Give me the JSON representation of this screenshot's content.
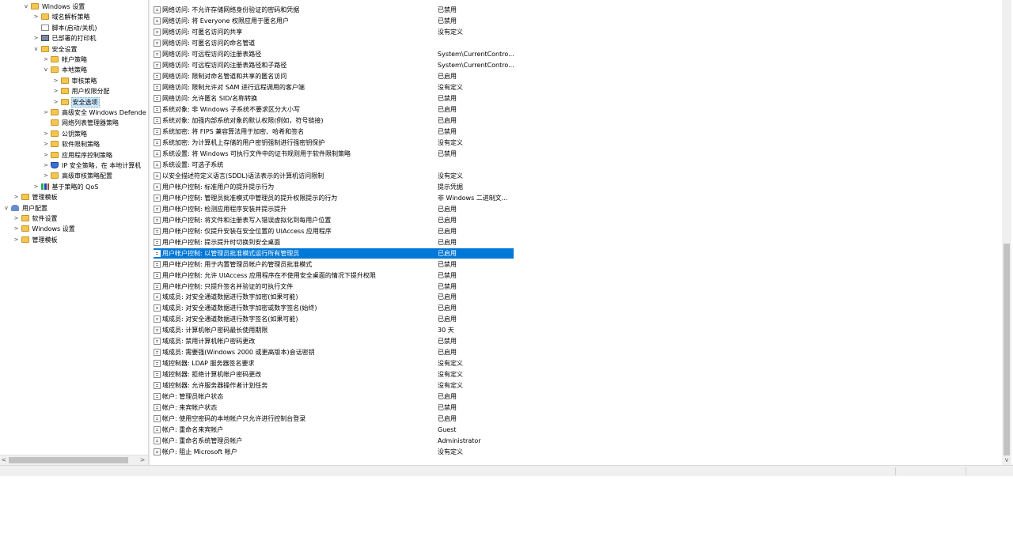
{
  "tree": [
    {
      "label": "Windows 设置",
      "level": 2,
      "toggle": "v",
      "icon": "folder"
    },
    {
      "label": "域名解析策略",
      "level": 3,
      "toggle": ">",
      "icon": "folder"
    },
    {
      "label": "脚本(启动/关机)",
      "level": 3,
      "toggle": "",
      "icon": "doc"
    },
    {
      "label": "已部署的打印机",
      "level": 3,
      "toggle": ">",
      "icon": "printer"
    },
    {
      "label": "安全设置",
      "level": 3,
      "toggle": "v",
      "icon": "folder"
    },
    {
      "label": "帐户策略",
      "level": 4,
      "toggle": ">",
      "icon": "folder"
    },
    {
      "label": "本地策略",
      "level": 4,
      "toggle": "v",
      "icon": "folder"
    },
    {
      "label": "审核策略",
      "level": 5,
      "toggle": ">",
      "icon": "folder"
    },
    {
      "label": "用户权限分配",
      "level": 5,
      "toggle": ">",
      "icon": "folder"
    },
    {
      "label": "安全选项",
      "level": 5,
      "toggle": ">",
      "icon": "folder",
      "selected": true
    },
    {
      "label": "高级安全 Windows Defender 防",
      "level": 4,
      "toggle": ">",
      "icon": "folder"
    },
    {
      "label": "网络列表管理器策略",
      "level": 4,
      "toggle": "",
      "icon": "folder"
    },
    {
      "label": "公钥策略",
      "level": 4,
      "toggle": ">",
      "icon": "folder"
    },
    {
      "label": "软件限制策略",
      "level": 4,
      "toggle": ">",
      "icon": "folder"
    },
    {
      "label": "应用程序控制策略",
      "level": 4,
      "toggle": ">",
      "icon": "folder"
    },
    {
      "label": "IP 安全策略，在 本地计算机",
      "level": 4,
      "toggle": ">",
      "icon": "shield"
    },
    {
      "label": "高级审核策略配置",
      "level": 4,
      "toggle": ">",
      "icon": "folder"
    },
    {
      "label": "基于策略的 QoS",
      "level": 3,
      "toggle": ">",
      "icon": "chart"
    },
    {
      "label": "管理模板",
      "level": 1,
      "toggle": ">",
      "icon": "folder"
    },
    {
      "label": "用户配置",
      "level": 0,
      "toggle": "v",
      "icon": "user"
    },
    {
      "label": "软件设置",
      "level": 1,
      "toggle": ">",
      "icon": "folder"
    },
    {
      "label": "Windows 设置",
      "level": 1,
      "toggle": ">",
      "icon": "folder"
    },
    {
      "label": "管理模板",
      "level": 1,
      "toggle": ">",
      "icon": "folder"
    }
  ],
  "policies": [
    {
      "name": "网络访问: 不允许存储网络身份验证的密码和凭据",
      "value": "已禁用"
    },
    {
      "name": "网络访问: 将 Everyone 权限应用于匿名用户",
      "value": "已禁用"
    },
    {
      "name": "网络访问: 可匿名访问的共享",
      "value": "没有定义"
    },
    {
      "name": "网络访问: 可匿名访问的命名管道",
      "value": ""
    },
    {
      "name": "网络访问: 可远程访问的注册表路径",
      "value": "System\\CurrentContro..."
    },
    {
      "name": "网络访问: 可远程访问的注册表路径和子路径",
      "value": "System\\CurrentContro..."
    },
    {
      "name": "网络访问: 限制对命名管道和共享的匿名访问",
      "value": "已启用"
    },
    {
      "name": "网络访问: 限制允许对 SAM 进行远程调用的客户端",
      "value": "没有定义"
    },
    {
      "name": "网络访问: 允许匿名 SID/名称转换",
      "value": "已禁用"
    },
    {
      "name": "系统对象: 非 Windows 子系统不要求区分大小写",
      "value": "已启用"
    },
    {
      "name": "系统对象: 加强内部系统对象的默认权限(例如，符号链接)",
      "value": "已启用"
    },
    {
      "name": "系统加密: 将 FIPS 兼容算法用于加密、哈希和签名",
      "value": "已禁用"
    },
    {
      "name": "系统加密: 为计算机上存储的用户密钥强制进行强密钥保护",
      "value": "没有定义"
    },
    {
      "name": "系统设置: 将 Windows 可执行文件中的证书规则用于软件限制策略",
      "value": "已禁用"
    },
    {
      "name": "系统设置: 可选子系统",
      "value": ""
    },
    {
      "name": "以安全描述符定义语言(SDDL)语法表示的计算机访问限制",
      "value": "没有定义"
    },
    {
      "name": "用户帐户控制: 标准用户的提升提示行为",
      "value": "提示凭据"
    },
    {
      "name": "用户帐户控制: 管理员批准模式中管理员的提升权限提示的行为",
      "value": "非 Windows 二进制文..."
    },
    {
      "name": "用户帐户控制: 检测应用程序安装并提示提升",
      "value": "已启用"
    },
    {
      "name": "用户帐户控制: 将文件和注册表写入错误虚拟化到每用户位置",
      "value": "已启用"
    },
    {
      "name": "用户帐户控制: 仅提升安装在安全位置的 UIAccess 应用程序",
      "value": "已启用"
    },
    {
      "name": "用户帐户控制: 提示提升时切换到安全桌面",
      "value": "已启用"
    },
    {
      "name": "用户帐户控制: 以管理员批准模式运行所有管理员",
      "value": "已启用",
      "selected": true
    },
    {
      "name": "用户帐户控制: 用于内置管理员帐户的管理员批准模式",
      "value": "已禁用"
    },
    {
      "name": "用户帐户控制: 允许 UIAccess 应用程序在不使用安全桌面的情况下提升权限",
      "value": "已禁用"
    },
    {
      "name": "用户帐户控制: 只提升签名并验证的可执行文件",
      "value": "已禁用"
    },
    {
      "name": "域成员: 对安全通道数据进行数字加密(如果可能)",
      "value": "已启用"
    },
    {
      "name": "域成员: 对安全通道数据进行数字加密或数字签名(始终)",
      "value": "已启用"
    },
    {
      "name": "域成员: 对安全通道数据进行数字签名(如果可能)",
      "value": "已启用"
    },
    {
      "name": "域成员: 计算机帐户密码最长使用期限",
      "value": "30 天"
    },
    {
      "name": "域成员: 禁用计算机帐户密码更改",
      "value": "已禁用"
    },
    {
      "name": "域成员: 需要强(Windows 2000 或更高版本)会话密钥",
      "value": "已启用"
    },
    {
      "name": "域控制器: LDAP 服务器签名要求",
      "value": "没有定义"
    },
    {
      "name": "域控制器: 拒绝计算机帐户密码更改",
      "value": "没有定义"
    },
    {
      "name": "域控制器: 允许服务器操作者计划任务",
      "value": "没有定义"
    },
    {
      "name": "帐户: 管理员帐户状态",
      "value": "已启用"
    },
    {
      "name": "帐户: 来宾帐户状态",
      "value": "已禁用"
    },
    {
      "name": "帐户: 使用空密码的本地帐户只允许进行控制台登录",
      "value": "已启用"
    },
    {
      "name": "帐户: 重命名来宾帐户",
      "value": "Guest"
    },
    {
      "name": "帐户: 重命名系统管理员帐户",
      "value": "Administrator"
    },
    {
      "name": "帐户: 阻止 Microsoft 帐户",
      "value": "没有定义"
    }
  ],
  "scroll": {
    "left_arrow": "<",
    "right_arrow": ">",
    "down_arrow": "v"
  },
  "colors": {
    "selection": "#0078d7",
    "tree_selection": "#cce8ff",
    "folder": "#f3c74f"
  }
}
